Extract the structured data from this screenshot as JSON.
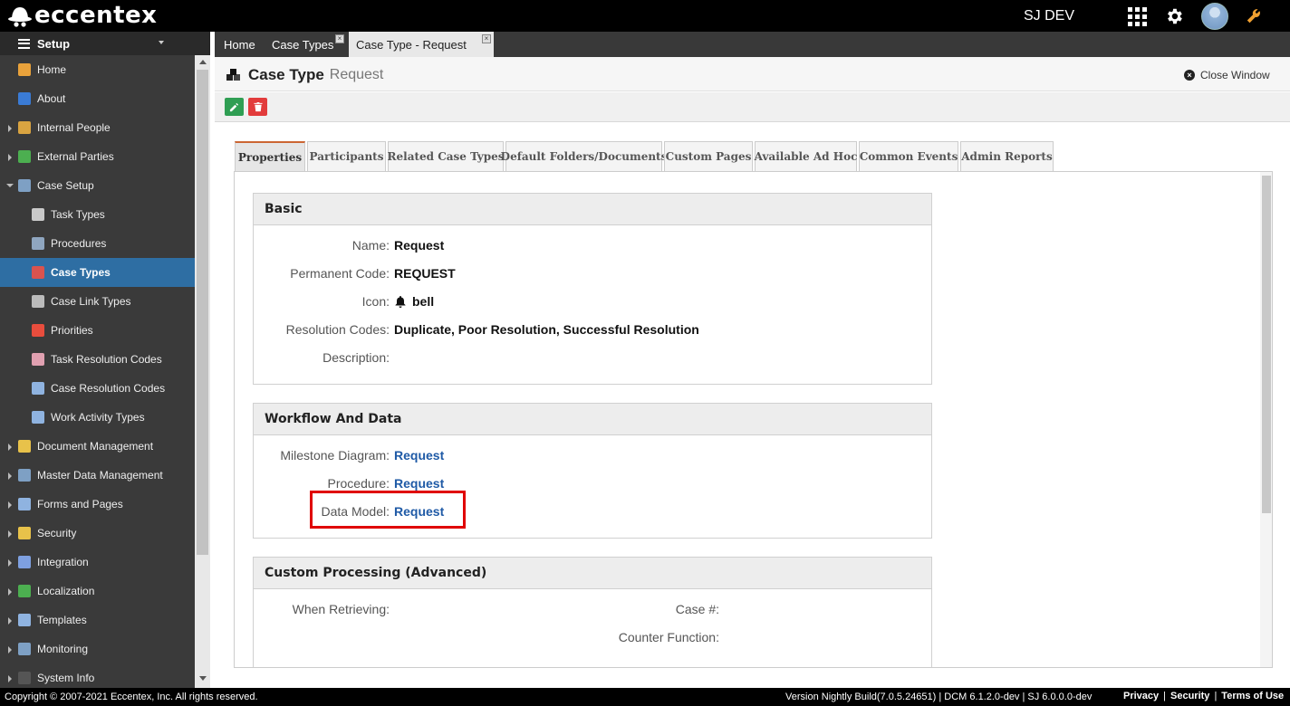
{
  "app": {
    "logo_text": "eccentex",
    "user_name": "SJ DEV"
  },
  "sidebar": {
    "header": "Setup",
    "items": [
      {
        "label": "Home",
        "level": 0,
        "icon": "home-icon",
        "color": "#e9a23b"
      },
      {
        "label": "About",
        "level": 0,
        "icon": "info-icon",
        "color": "#3a7bd5"
      },
      {
        "label": "Internal People",
        "level": 0,
        "expandable": true,
        "icon": "people-icon",
        "color": "#d9a441"
      },
      {
        "label": "External Parties",
        "level": 0,
        "expandable": true,
        "icon": "globe-icon",
        "color": "#4caf50"
      },
      {
        "label": "Case Setup",
        "level": 0,
        "expanded": true,
        "icon": "case-setup-icon",
        "color": "#7ea0c4"
      },
      {
        "label": "Task Types",
        "level": 1,
        "icon": "task-types-icon",
        "color": "#c9c9c9"
      },
      {
        "label": "Procedures",
        "level": 1,
        "icon": "procedures-icon",
        "color": "#8fa6c0"
      },
      {
        "label": "Case Types",
        "level": 1,
        "active": true,
        "icon": "case-types-icon",
        "color": "#d9534f"
      },
      {
        "label": "Case Link Types",
        "level": 1,
        "icon": "link-icon",
        "color": "#bbbbbb"
      },
      {
        "label": "Priorities",
        "level": 1,
        "icon": "priorities-icon",
        "color": "#e84d3d"
      },
      {
        "label": "Task Resolution Codes",
        "level": 1,
        "icon": "tag-icon",
        "color": "#e0a0b0"
      },
      {
        "label": "Case Resolution Codes",
        "level": 1,
        "icon": "tag-icon",
        "color": "#8fb3e0"
      },
      {
        "label": "Work Activity Types",
        "level": 1,
        "icon": "phone-icon",
        "color": "#8fb3e0"
      },
      {
        "label": "Document Management",
        "level": 0,
        "expandable": true,
        "icon": "folder-icon",
        "color": "#e8c24a"
      },
      {
        "label": "Master Data Management",
        "level": 0,
        "expandable": true,
        "icon": "table-icon",
        "color": "#7ea0c4"
      },
      {
        "label": "Forms and Pages",
        "level": 0,
        "expandable": true,
        "icon": "forms-icon",
        "color": "#8fb3e0"
      },
      {
        "label": "Security",
        "level": 0,
        "expandable": true,
        "icon": "lock-icon",
        "color": "#e8c24a"
      },
      {
        "label": "Integration",
        "level": 0,
        "expandable": true,
        "icon": "integration-icon",
        "color": "#7ea0e0"
      },
      {
        "label": "Localization",
        "level": 0,
        "expandable": true,
        "icon": "globe-icon",
        "color": "#4caf50"
      },
      {
        "label": "Templates",
        "level": 0,
        "expandable": true,
        "icon": "templates-icon",
        "color": "#8fb3e0"
      },
      {
        "label": "Monitoring",
        "level": 0,
        "expandable": true,
        "icon": "monitor-icon",
        "color": "#7ea0c4"
      },
      {
        "label": "System Info",
        "level": 0,
        "expandable": true,
        "icon": "console-icon",
        "color": "#555555"
      }
    ]
  },
  "top_tabs": [
    {
      "label": "Home"
    },
    {
      "label": "Case Types",
      "closable": true
    },
    {
      "label": "Case Type - Request",
      "closable": true,
      "active": true
    }
  ],
  "page": {
    "title": "Case Type",
    "subtitle": "Request",
    "close_window": "Close Window"
  },
  "property_tabs": [
    "Properties",
    "Participants",
    "Related Case Types",
    "Default Folders/Documents",
    "Custom Pages",
    "Available Ad Hoc",
    "Common Events",
    "Admin Reports"
  ],
  "basic": {
    "title": "Basic",
    "name_label": "Name:",
    "name_value": "Request",
    "code_label": "Permanent Code:",
    "code_value": "REQUEST",
    "icon_label": "Icon:",
    "icon_value": "bell",
    "resolution_label": "Resolution Codes:",
    "resolution_value": "Duplicate, Poor Resolution, Successful Resolution",
    "description_label": "Description:"
  },
  "workflow": {
    "title": "Workflow And Data",
    "milestone_label": "Milestone Diagram:",
    "milestone_value": "Request",
    "procedure_label": "Procedure:",
    "procedure_value": "Request",
    "datamodel_label": "Data Model:",
    "datamodel_value": "Request"
  },
  "custom": {
    "title": "Custom Processing (Advanced)",
    "retrieving_label": "When Retrieving:",
    "case_no_label": "Case #:",
    "counter_label": "Counter Function:"
  },
  "footer": {
    "copyright": "Copyright © 2007-2021 Eccentex, Inc. All rights reserved.",
    "version": "Version   Nightly Build(7.0.5.24651) | DCM 6.1.2.0-dev | SJ 6.0.0.0-dev",
    "privacy": "Privacy",
    "security": "Security",
    "terms": "Terms of Use"
  }
}
